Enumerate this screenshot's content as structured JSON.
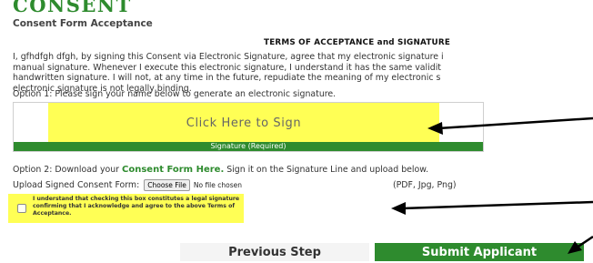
{
  "page": {
    "title": "CONSENT",
    "subtitle": "Consent Form Acceptance"
  },
  "terms": {
    "heading": "TERMS OF ACCEPTANCE and SIGNATURE",
    "lines": [
      "I, gfhdfgh dfgh, by signing this Consent via Electronic Signature, agree that my electronic signature i",
      "manual signature. Whenever I execute this electronic signature, I understand it has the same validit",
      "handwritten signature. I will not, at any time in the future, repudiate the meaning of my electronic s",
      "electronic signature is not legally binding."
    ]
  },
  "option1": {
    "text": "Option 1: Please sign your name below to generate an electronic signature.",
    "sign_button": "Click Here to Sign",
    "signature_label": "Signature (Required)"
  },
  "option2": {
    "text_before": "Option 2: Download your ",
    "link": "Consent Form Here.",
    "text_after": " Sign it on the Signature Line and upload below."
  },
  "upload": {
    "label": "Upload Signed Consent Form:",
    "choose_button": "Choose File",
    "no_file": "No file chosen",
    "formats": "(PDF, Jpg, Png)"
  },
  "consent_checkbox": {
    "checked": false,
    "lines": [
      "I understand that checking this box constitutes a legal signature",
      "confirming that I acknowledge and agree to the above Terms of",
      "Acceptance."
    ]
  },
  "buttons": {
    "previous": "Previous Step",
    "submit": "Submit Applicant"
  },
  "colors": {
    "brand_green": "#2e8b2e",
    "highlight_yellow": "#ffff55",
    "annotation_arrows": "#000000"
  },
  "icons": {
    "arrows": "left-pointing-arrow-icon"
  }
}
